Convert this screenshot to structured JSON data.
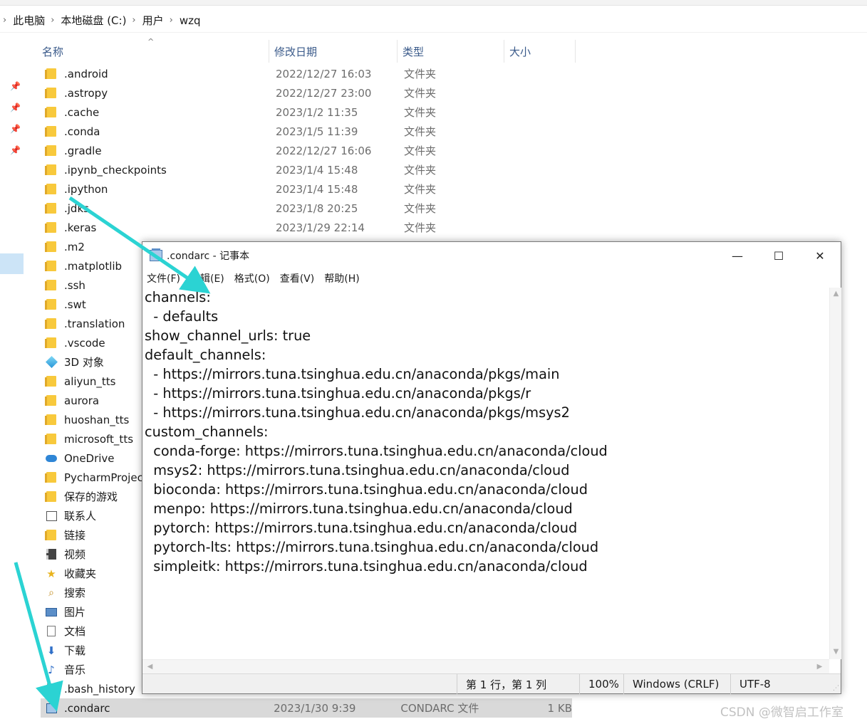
{
  "explorer": {
    "breadcrumb": [
      "此电脑",
      "本地磁盘 (C:)",
      "用户",
      "wzq"
    ],
    "columns": {
      "name": "名称",
      "date": "修改日期",
      "type": "类型",
      "size": "大小"
    },
    "files": [
      {
        "name": ".android",
        "date": "2022/12/27 16:03",
        "type": "文件夹",
        "icon": "folder-icon"
      },
      {
        "name": ".astropy",
        "date": "2022/12/27 23:00",
        "type": "文件夹",
        "icon": "folder-icon"
      },
      {
        "name": ".cache",
        "date": "2023/1/2 11:35",
        "type": "文件夹",
        "icon": "folder-icon"
      },
      {
        "name": ".conda",
        "date": "2023/1/5 11:39",
        "type": "文件夹",
        "icon": "folder-icon"
      },
      {
        "name": ".gradle",
        "date": "2022/12/27 16:06",
        "type": "文件夹",
        "icon": "folder-icon"
      },
      {
        "name": ".ipynb_checkpoints",
        "date": "2023/1/4 15:48",
        "type": "文件夹",
        "icon": "folder-icon"
      },
      {
        "name": ".ipython",
        "date": "2023/1/4 15:48",
        "type": "文件夹",
        "icon": "folder-icon"
      },
      {
        "name": ".jdks",
        "date": "2023/1/8 20:25",
        "type": "文件夹",
        "icon": "folder-icon"
      },
      {
        "name": ".keras",
        "date": "2023/1/29 22:14",
        "type": "文件夹",
        "icon": "folder-icon"
      },
      {
        "name": ".m2",
        "icon": "folder-icon"
      },
      {
        "name": ".matplotlib",
        "icon": "folder-icon"
      },
      {
        "name": ".ssh",
        "icon": "folder-icon"
      },
      {
        "name": ".swt",
        "icon": "folder-icon"
      },
      {
        "name": ".translation",
        "icon": "folder-icon"
      },
      {
        "name": ".vscode",
        "icon": "folder-icon"
      },
      {
        "name": "3D 对象",
        "icon": "3d-objects-icon"
      },
      {
        "name": "aliyun_tts",
        "icon": "folder-icon"
      },
      {
        "name": "aurora",
        "icon": "folder-icon"
      },
      {
        "name": "huoshan_tts",
        "icon": "folder-icon"
      },
      {
        "name": "microsoft_tts",
        "icon": "folder-icon"
      },
      {
        "name": "OneDrive",
        "icon": "onedrive-icon"
      },
      {
        "name": "PycharmProjects",
        "icon": "folder-icon"
      },
      {
        "name": "保存的游戏",
        "icon": "saved-games-icon"
      },
      {
        "name": "联系人",
        "icon": "contacts-icon"
      },
      {
        "name": "链接",
        "icon": "links-icon"
      },
      {
        "name": "视频",
        "icon": "videos-icon"
      },
      {
        "name": "收藏夹",
        "icon": "favorites-icon"
      },
      {
        "name": "搜索",
        "icon": "searches-icon"
      },
      {
        "name": "图片",
        "icon": "pictures-icon"
      },
      {
        "name": "文档",
        "icon": "documents-icon"
      },
      {
        "name": "下载",
        "icon": "downloads-icon"
      },
      {
        "name": "音乐",
        "icon": "music-icon"
      },
      {
        "name": ".bash_history",
        "icon": "file-icon"
      },
      {
        "name": ".condarc",
        "date": "2023/1/30 9:39",
        "type": "CONDARC 文件",
        "size": "1 KB",
        "icon": "condarc-file-icon",
        "selected": true
      }
    ]
  },
  "notepad": {
    "title": ".condarc - 记事本",
    "controls": {
      "minimize": "—",
      "maximize": "☐",
      "close": "✕"
    },
    "menu": [
      "文件(F)",
      "编辑(E)",
      "格式(O)",
      "查看(V)",
      "帮助(H)"
    ],
    "lines": [
      "channels:",
      "  - defaults",
      "show_channel_urls: true",
      "default_channels:",
      "  - https://mirrors.tuna.tsinghua.edu.cn/anaconda/pkgs/main",
      "  - https://mirrors.tuna.tsinghua.edu.cn/anaconda/pkgs/r",
      "  - https://mirrors.tuna.tsinghua.edu.cn/anaconda/pkgs/msys2",
      "custom_channels:",
      "  conda-forge: https://mirrors.tuna.tsinghua.edu.cn/anaconda/cloud",
      "  msys2: https://mirrors.tuna.tsinghua.edu.cn/anaconda/cloud",
      "  bioconda: https://mirrors.tuna.tsinghua.edu.cn/anaconda/cloud",
      "  menpo: https://mirrors.tuna.tsinghua.edu.cn/anaconda/cloud",
      "  pytorch: https://mirrors.tuna.tsinghua.edu.cn/anaconda/cloud",
      "  pytorch-lts: https://mirrors.tuna.tsinghua.edu.cn/anaconda/cloud",
      "  simpleitk: https://mirrors.tuna.tsinghua.edu.cn/anaconda/cloud"
    ],
    "status": {
      "position": "第 1 行，第 1 列",
      "zoom": "100%",
      "line_ending": "Windows (CRLF)",
      "encoding": "UTF-8"
    }
  },
  "watermark": "CSDN @微智启工作室",
  "colors": {
    "arrow": "#2bd3d3",
    "folder": "#f8c93c",
    "selection": "#d9d9d9",
    "header_text": "#3a5a8a"
  }
}
